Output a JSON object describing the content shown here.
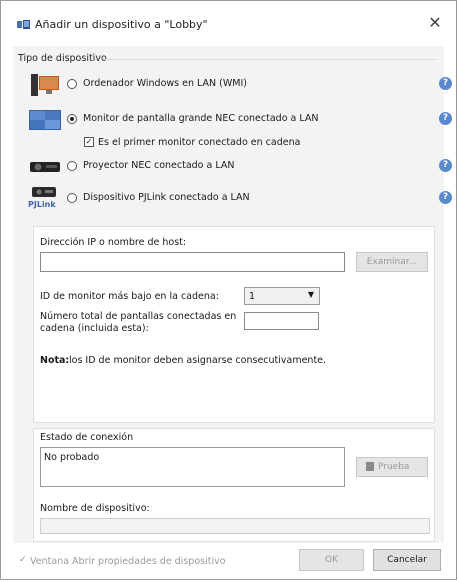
{
  "window": {
    "title": "Añadir un dispositivo a \"Lobby\"",
    "close_glyph": "✕"
  },
  "device_type": {
    "label": "Tipo de dispositivo",
    "options": [
      {
        "label": "Ordenador Windows en LAN (WMI)",
        "icon": "computer-monitor-icon",
        "selected": false
      },
      {
        "label": "Monitor de pantalla grande NEC conectado a LAN",
        "icon": "large-display-icon",
        "selected": true
      },
      {
        "label": "Proyector NEC conectado a LAN",
        "icon": "projector-icon",
        "selected": false
      },
      {
        "label": "Dispositivo PJLink conectado a LAN",
        "icon": "pjlink-icon",
        "selected": false
      }
    ],
    "first_in_chain_label": "Es el primer monitor conectado en cadena",
    "first_in_chain_checked": true,
    "pjlink_logo_text": "PJLink",
    "help_glyph": "?"
  },
  "connection": {
    "ip_label": "Dirección IP o nombre de host:",
    "ip_value": "",
    "browse_button": "Examinar...",
    "lowest_id_label": "ID de monitor más bajo en la cadena:",
    "lowest_id_value": "1",
    "total_label_line1": "Número total de pantallas conectadas en",
    "total_label_line2": "cadena (incluida esta):",
    "total_value": "",
    "note_bold": "Nota:",
    "note_text": " los ID de monitor deben asignarse consecutivamente."
  },
  "status": {
    "label": "Estado de conexión",
    "value": "No probado",
    "test_button": "Prueba",
    "device_name_label": "Nombre de dispositivo:",
    "device_name_value": ""
  },
  "footer": {
    "open_props_label": "Ventana Abrir propiedades de dispositivo",
    "open_props_checked": true,
    "ok_button": "OK",
    "cancel_button": "Cancelar"
  },
  "colors": {
    "accent": "#5b87cc",
    "panel_bg": "#f3f3f3"
  }
}
